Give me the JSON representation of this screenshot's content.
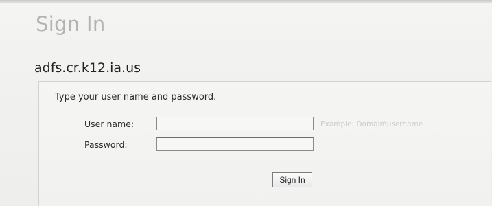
{
  "page": {
    "title": "Sign In",
    "domain": "adfs.cr.k12.ia.us"
  },
  "form": {
    "instructions": "Type your user name and password.",
    "username": {
      "label": "User name:",
      "value": "",
      "hint": "Example: Domain\\username"
    },
    "password": {
      "label": "Password:",
      "value": ""
    },
    "submit_label": "Sign In"
  }
}
